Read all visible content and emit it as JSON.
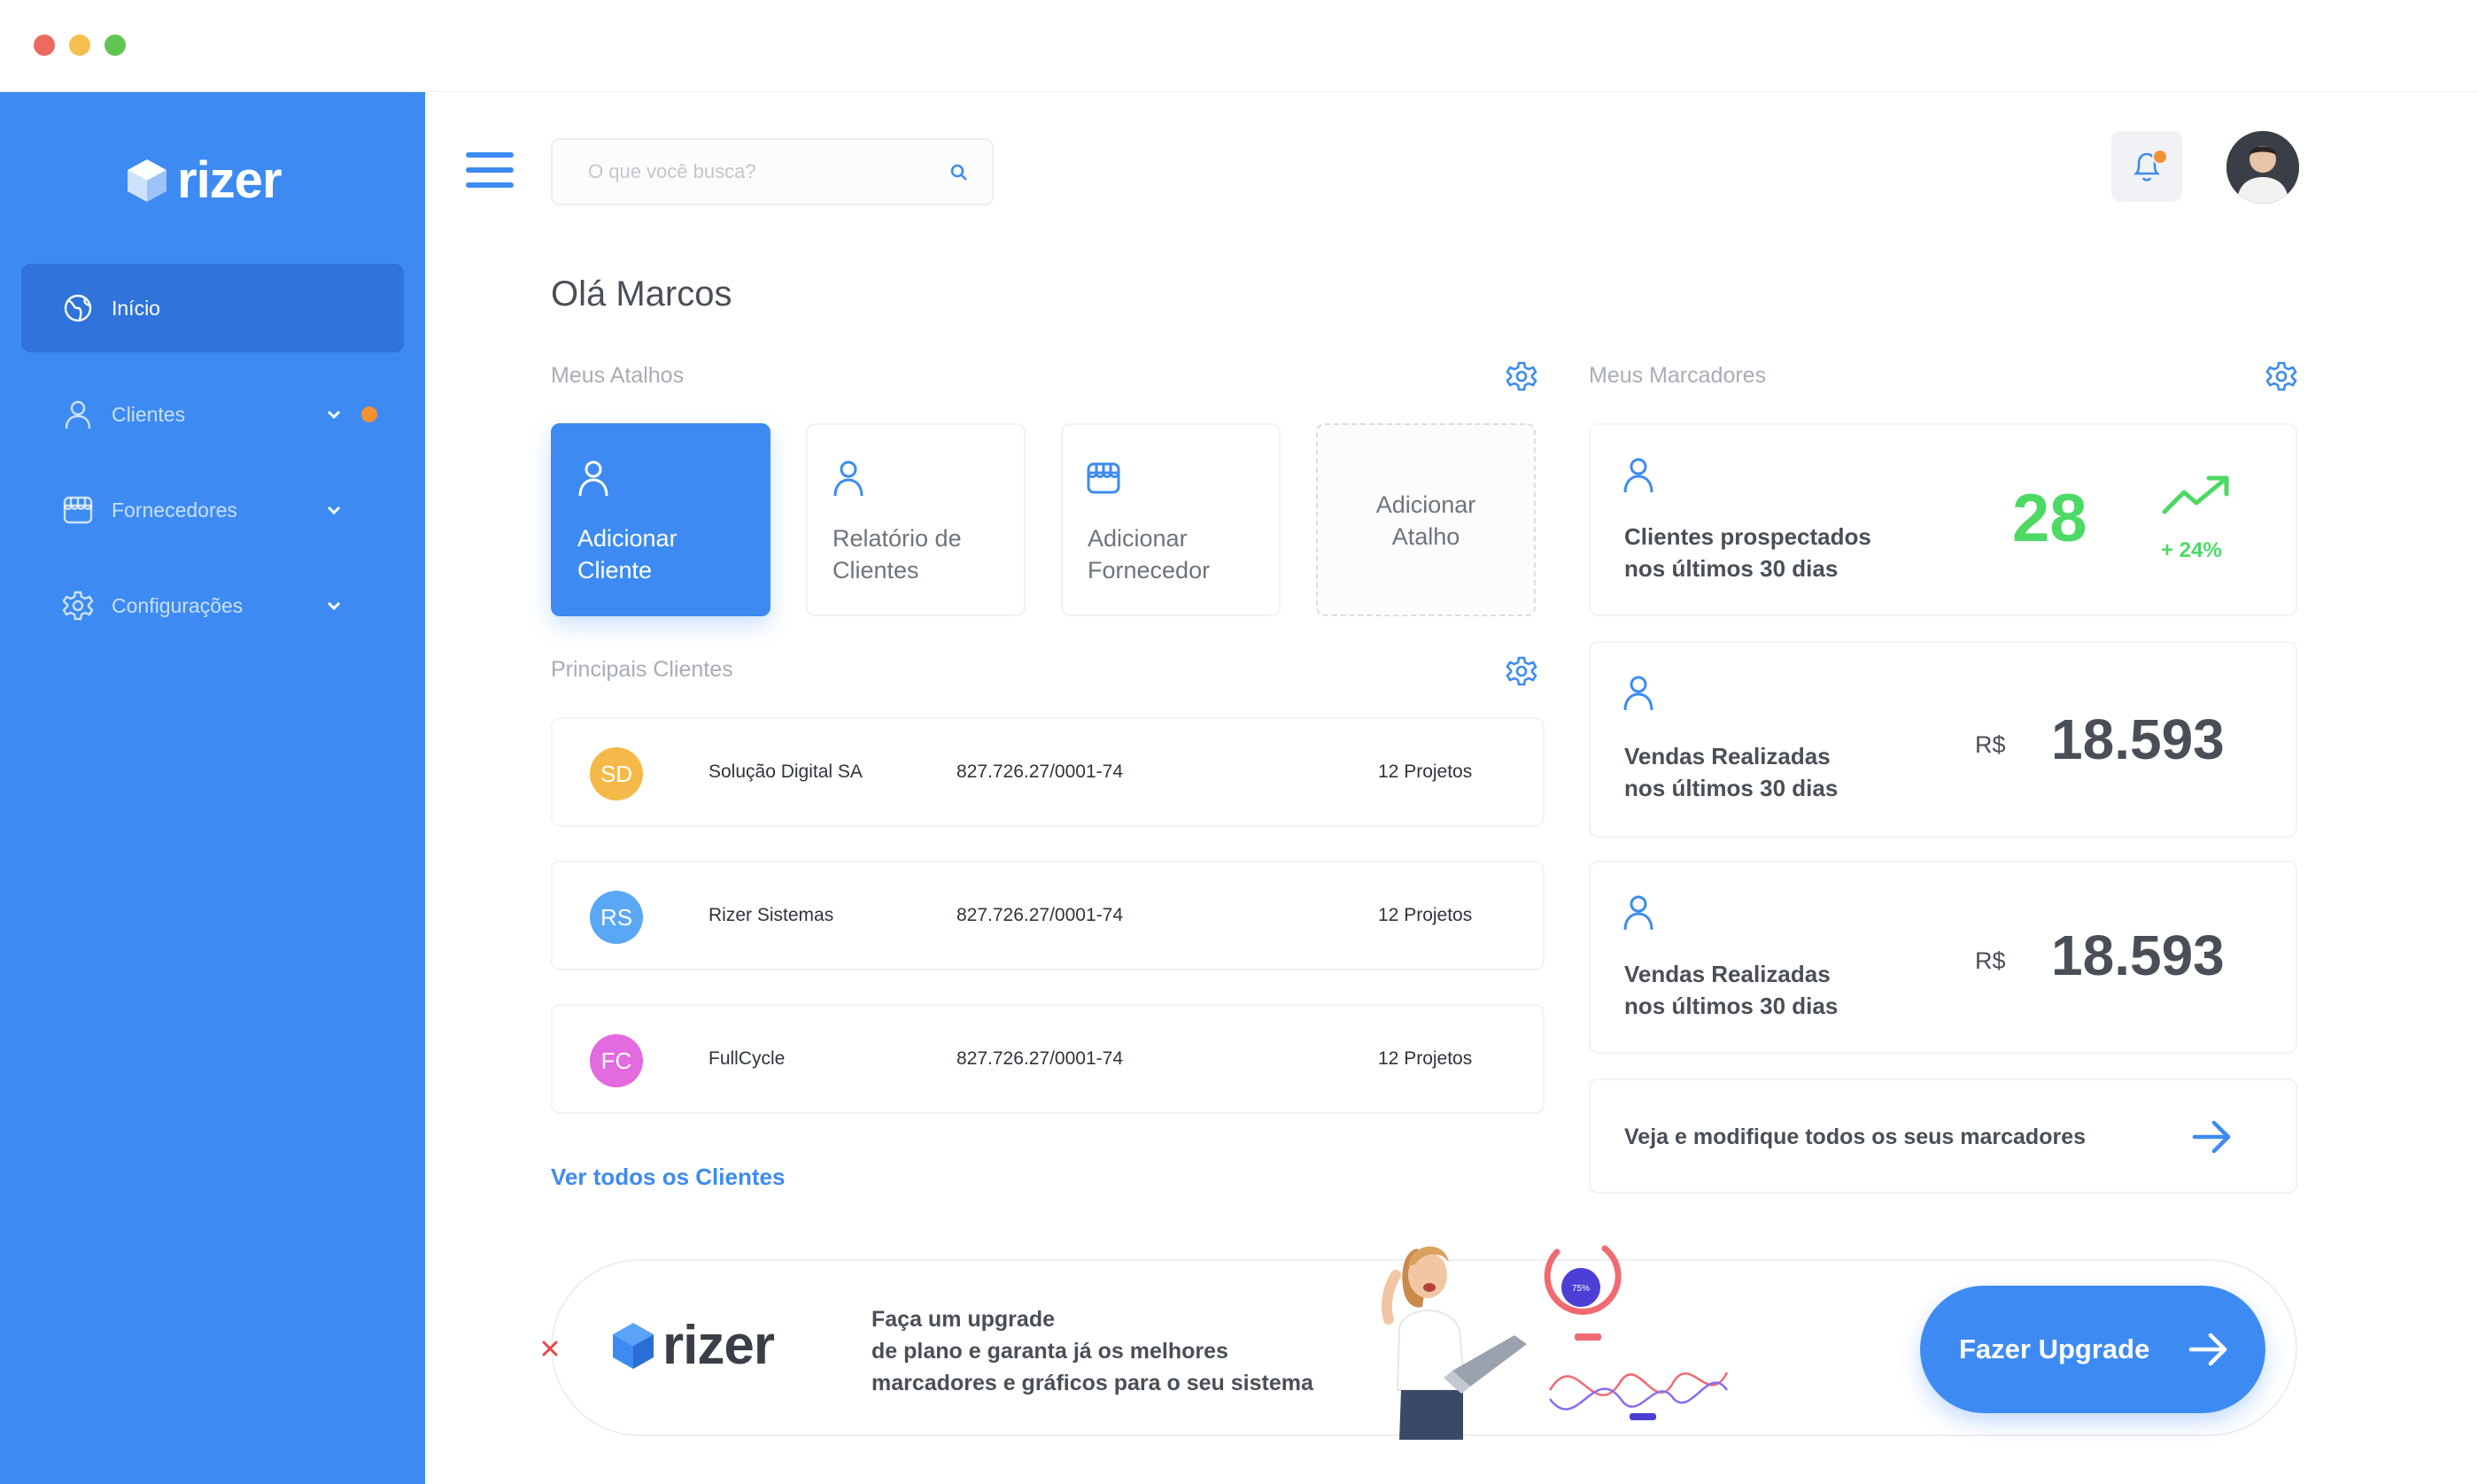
{
  "window": {
    "controls": [
      "close",
      "minimize",
      "maximize"
    ]
  },
  "brand": {
    "name": "rizer",
    "primary_color": "#3d8bf2",
    "accent_color": "#f39232",
    "success_color": "#4cd964"
  },
  "sidebar": {
    "items": [
      {
        "label": "Início",
        "icon": "globe-icon",
        "active": true
      },
      {
        "label": "Clientes",
        "icon": "user-icon",
        "has_dropdown": true,
        "has_notification": true
      },
      {
        "label": "Fornecedores",
        "icon": "store-icon",
        "has_dropdown": true
      },
      {
        "label": "Configurações",
        "icon": "gear-icon",
        "has_dropdown": true
      }
    ]
  },
  "header": {
    "search_placeholder": "O que você busca?",
    "notification_badge": true
  },
  "greeting": "Olá Marcos",
  "shortcuts": {
    "title": "Meus Atalhos",
    "items": [
      {
        "label": "Adicionar\nCliente",
        "icon": "user-icon"
      },
      {
        "label": "Relatório de\nClientes",
        "icon": "user-icon"
      },
      {
        "label": "Adicionar\nFornecedor",
        "icon": "store-icon"
      },
      {
        "label": "Adicionar\nAtalho"
      }
    ]
  },
  "clients": {
    "title": "Principais Clientes",
    "rows": [
      {
        "initials": "SD",
        "name": "Solução Digital SA",
        "document": "827.726.27/0001-74",
        "projects": "12 Projetos",
        "color": "#f5b94a"
      },
      {
        "initials": "RS",
        "name": "Rizer Sistemas",
        "document": "827.726.27/0001-74",
        "projects": "12 Projetos",
        "color": "#5aa8f5"
      },
      {
        "initials": "FC",
        "name": "FullCycle",
        "document": "827.726.27/0001-74",
        "projects": "12 Projetos",
        "color": "#e46adf"
      }
    ],
    "see_all": "Ver todos os Clientes"
  },
  "markers": {
    "title": "Meus Marcadores",
    "items": [
      {
        "label_line1": "Clientes prospectados",
        "label_line2": "nos últimos 30 dias",
        "value": "28",
        "trend": "+ 24%"
      },
      {
        "label_line1": "Vendas Realizadas",
        "label_line2": "nos últimos 30 dias",
        "currency": "R$",
        "value": "18.593"
      },
      {
        "label_line1": "Vendas Realizadas",
        "label_line2": "nos últimos 30 dias",
        "currency": "R$",
        "value": "18.593"
      }
    ],
    "link": "Veja e modifique todos os seus marcadores"
  },
  "banner": {
    "logo": "rizer",
    "text_line1": "Faça um upgrade",
    "text_line2": "de plano e garanta já os melhores",
    "text_line3": "marcadores e gráficos para o seu sistema",
    "gauge_label": "75%",
    "button": "Fazer Upgrade"
  }
}
